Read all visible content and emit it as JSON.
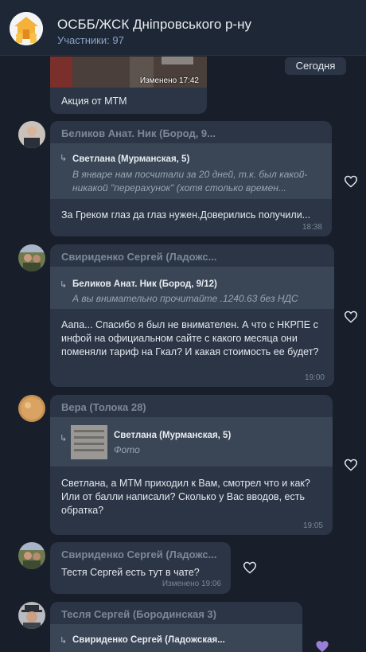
{
  "header": {
    "title": "ОСББ/ЖСК Дніпровського р-ну",
    "members_label": "Участники:",
    "members_count": "97"
  },
  "date_divider": "Сегодня",
  "messages": [
    {
      "text": "Акция от МТМ",
      "image_caption": "Изменено 17:42"
    },
    {
      "sender": "Беликов Анат. Ник (Бород, 9...",
      "reply_author": "Светлана (Мурманская, 5)",
      "reply_text_1": "В январе нам посчитали за 20 дней, т.к. был какой-",
      "reply_text_2": "никакой \"перерахунок\" (хотя столько времен...",
      "text": "За Греком глаз да глаз нужен.Доверились получили...",
      "time": "18:38"
    },
    {
      "sender": "Свириденко Сергей (Ладожс...",
      "reply_author": "Беликов Анат. Ник (Бород, 9/12)",
      "reply_text": "А вы внимательно прочитайте  .1240.63 без НДС",
      "text": "Аапа... Спасибо я был не внимателен.  А что с НКРПЕ с инфой на официальном сайте с какого месяца они поменяли тариф на Гкал?  И какая стоимость ее будет?",
      "time": "19:00"
    },
    {
      "sender": "Вера (Толока 28)",
      "reply_author": "Светлана (Мурманская, 5)",
      "reply_text": "Фото",
      "text": "Светлана, а МТМ приходил к Вам, смотрел что и как? Или от балли написали? Сколько у Вас вводов, есть обратка?",
      "time": "19:05"
    },
    {
      "sender": "Свириденко Сергей (Ладожс...",
      "text": "Тестя Сергей есть тут в чате?",
      "time": "Изменено 19:06"
    },
    {
      "sender": "Тесля Сергей (Бородинская 3)",
      "reply_author": "Свириденко Сергей (Ладожская..."
    }
  ],
  "colors": {
    "background": "#181f2b",
    "bubble": "#2b3545",
    "quote": "#3a4556",
    "accent": "#8aa3c8"
  }
}
